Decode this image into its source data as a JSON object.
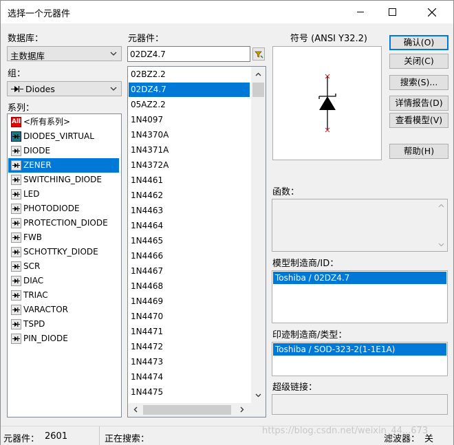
{
  "window": {
    "title": "选择一个元器件"
  },
  "database": {
    "label": "数据库：",
    "selected": "主数据库"
  },
  "group": {
    "label": "组：",
    "selected": "Diodes"
  },
  "family": {
    "label": "系列：",
    "items": [
      {
        "label": "<所有系列>",
        "icon": "all-families-icon",
        "glyph": "All"
      },
      {
        "label": "DIODES_VIRTUAL",
        "icon": "virtual-diode-icon"
      },
      {
        "label": "DIODE",
        "icon": "diode-icon"
      },
      {
        "label": "ZENER",
        "icon": "zener-icon",
        "selected": true
      },
      {
        "label": "SWITCHING_DIODE",
        "icon": "switching-diode-icon"
      },
      {
        "label": "LED",
        "icon": "led-icon"
      },
      {
        "label": "PHOTODIODE",
        "icon": "photodiode-icon"
      },
      {
        "label": "PROTECTION_DIODE",
        "icon": "protection-diode-icon"
      },
      {
        "label": "FWB",
        "icon": "bridge-rectifier-icon"
      },
      {
        "label": "SCHOTTKY_DIODE",
        "icon": "schottky-diode-icon"
      },
      {
        "label": "SCR",
        "icon": "scr-icon"
      },
      {
        "label": "DIAC",
        "icon": "diac-icon"
      },
      {
        "label": "TRIAC",
        "icon": "triac-icon"
      },
      {
        "label": "VARACTOR",
        "icon": "varactor-icon"
      },
      {
        "label": "TSPD",
        "icon": "tspd-icon"
      },
      {
        "label": "PIN_DIODE",
        "icon": "pin-diode-icon"
      }
    ]
  },
  "component": {
    "label": "元器件：",
    "search_value": "02DZ4.7",
    "items": [
      "02BZ2.2",
      "02DZ4.7",
      "05AZ2.2",
      "1N4097",
      "1N4370A",
      "1N4371A",
      "1N4372A",
      "1N4461",
      "1N4462",
      "1N4463",
      "1N4464",
      "1N4465",
      "1N4466",
      "1N4467",
      "1N4468",
      "1N4469",
      "1N4470",
      "1N4471",
      "1N4472",
      "1N4473",
      "1N4474",
      "1N4475"
    ],
    "selected_index": 1
  },
  "symbol": {
    "label": "符号 (ANSI Y32.2)"
  },
  "buttons": {
    "ok": "确认(O)",
    "close": "关闭(C)",
    "search": "搜索(S)...",
    "detail": "详情报告(D)",
    "model": "查看模型(V)",
    "help": "帮助(H)"
  },
  "function": {
    "label": "函数："
  },
  "model_maker": {
    "label": "模型制造商/ID：",
    "value": "Toshiba / 02DZ4.7"
  },
  "footprint": {
    "label": "印迹制造商/类型：",
    "value": "Toshiba / SOD-323-2(1-1E1A)"
  },
  "hyperlink": {
    "label": "超级链接："
  },
  "status": {
    "count_label": "元器件：",
    "count_value": "2601",
    "searching_label": "正在搜索：",
    "filter_label": "滤波器：",
    "filter_value": "关"
  },
  "watermark": "https://blog.csdn.net/weixin_44...673"
}
